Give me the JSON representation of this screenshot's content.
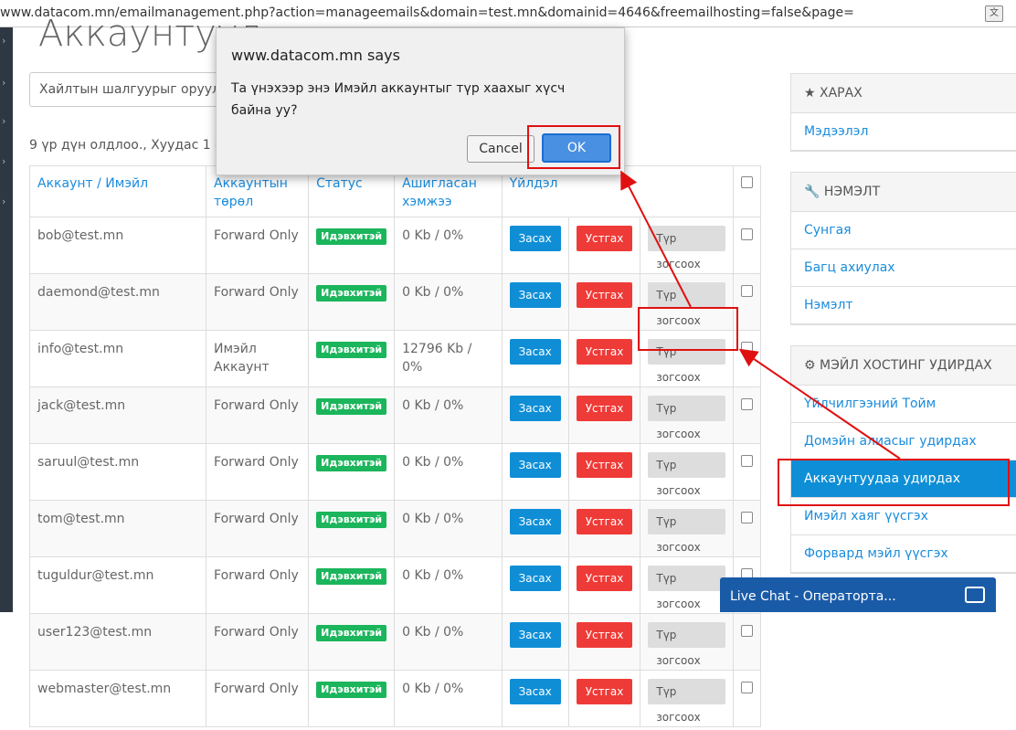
{
  "browser": {
    "url": "www.datacom.mn/emailmanagement.php?action=manageemails&domain=test.mn&domainid=4646&freemailhosting=false&page="
  },
  "page": {
    "title": "Аккаунтууд",
    "search_placeholder": "Хайлтын шалгуурыг оруулна у",
    "results_text": "9 үр дүн олдлоо., Хуудас 1 -с 1"
  },
  "table": {
    "headers": {
      "account": "Аккаунт / Имэйл",
      "type": "Аккаунтын төрөл",
      "status": "Статус",
      "usage": "Ашигласан хэмжээ",
      "actions": "Үйлдэл"
    },
    "edit_label": "Засах",
    "delete_label": "Устгах",
    "pause_label": "Түр зогсоох",
    "rows": [
      {
        "email": "bob@test.mn",
        "type": "Forward Only",
        "status": "Идэвхитэй",
        "usage": "0 Kb / 0%"
      },
      {
        "email": "daemond@test.mn",
        "type": "Forward Only",
        "status": "Идэвхитэй",
        "usage": "0 Kb / 0%"
      },
      {
        "email": "info@test.mn",
        "type": "Имэйл Аккаунт",
        "status": "Идэвхитэй",
        "usage": "12796 Kb / 0%"
      },
      {
        "email": "jack@test.mn",
        "type": "Forward Only",
        "status": "Идэвхитэй",
        "usage": "0 Kb / 0%"
      },
      {
        "email": "saruul@test.mn",
        "type": "Forward Only",
        "status": "Идэвхитэй",
        "usage": "0 Kb / 0%"
      },
      {
        "email": "tom@test.mn",
        "type": "Forward Only",
        "status": "Идэвхитэй",
        "usage": "0 Kb / 0%"
      },
      {
        "email": "tuguldur@test.mn",
        "type": "Forward Only",
        "status": "Идэвхитэй",
        "usage": "0 Kb / 0%"
      },
      {
        "email": "user123@test.mn",
        "type": "Forward Only",
        "status": "Идэвхитэй",
        "usage": "0 Kb / 0%"
      },
      {
        "email": "webmaster@test.mn",
        "type": "Forward Only",
        "status": "Идэвхитэй",
        "usage": "0 Kb / 0%"
      }
    ]
  },
  "sidebar": {
    "view": {
      "title": "ХАРАХ",
      "items": [
        "Мэдээлэл"
      ]
    },
    "addon": {
      "title": "НЭМЭЛТ",
      "items": [
        "Сунгая",
        "Багц ахиулах",
        "Нэмэлт"
      ]
    },
    "mail": {
      "title": "МЭЙЛ ХОСТИНГ УДИРДАХ",
      "items": [
        "Үйлчилгээний Тойм",
        "Домэйн алиасыг удирдах",
        "Аккаунтуудаа удирдах",
        "Имэйл хаяг үүсгэх",
        "Форвард мэйл үүсгэх"
      ]
    }
  },
  "dialog": {
    "title": "www.datacom.mn says",
    "message": "Та үнэхээр энэ Имэйл аккаунтыг түр хаахыг хүсч байна уу?",
    "cancel_label": "Cancel",
    "ok_label": "OK"
  },
  "chat": {
    "label": "Live Chat - Оператортa..."
  },
  "colors": {
    "accent": "#1a8cdd",
    "success": "#1bb55c",
    "danger": "#ee3b37",
    "highlight": "#e01010"
  }
}
